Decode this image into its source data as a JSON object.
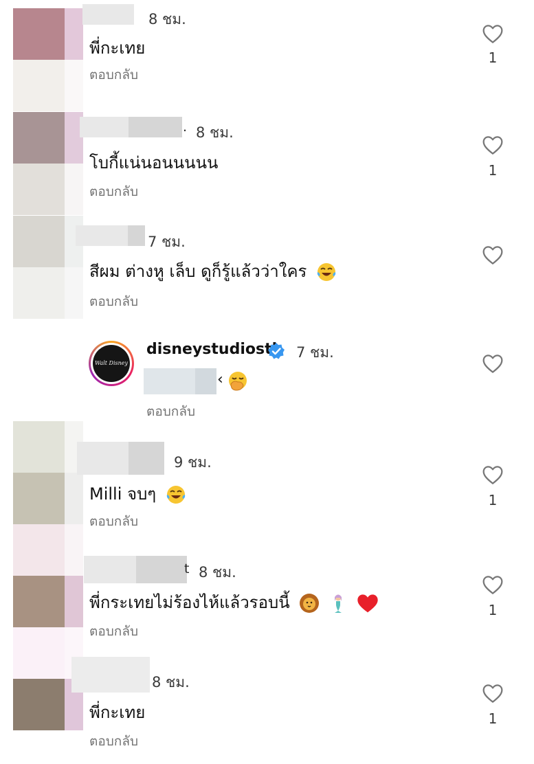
{
  "reply_label": "ตอบกลับ",
  "comments": [
    {
      "time": "8 ชม.",
      "text": "พี่กะเทย",
      "likes": "1",
      "name_tail": "",
      "emojis": []
    },
    {
      "time": "8 ชม.",
      "text": "โบกี้แน่นอนนนนน",
      "likes": "1",
      "name_tail": ".",
      "emojis": []
    },
    {
      "time": "7 ชม.",
      "text": "สีผม ต่างหู เล็บ ดูก็รู้แล้วว่าใคร",
      "likes": "",
      "name_tail": "",
      "emojis": [
        "laughing-tears"
      ]
    },
    {
      "time": "9 ชม.",
      "text": "Milli จบๆ",
      "likes": "1",
      "name_tail": "",
      "emojis": [
        "laughing-tears"
      ]
    },
    {
      "time": "8 ชม.",
      "text": "พี่กระเทยไม่ร้องไห้แล้วรอบนี้",
      "likes": "1",
      "name_tail": "t",
      "emojis": [
        "lion",
        "mermaid",
        "red-heart"
      ]
    },
    {
      "time": "8 ชม.",
      "text": "พี่กะเทย",
      "likes": "1",
      "name_tail": "",
      "emojis": []
    }
  ],
  "reply": {
    "username": "disneystudiosth",
    "time": "7 ชม.",
    "mention_tail": "‹",
    "emoji": "hand-over-mouth",
    "logo_text": "Walt Disney"
  },
  "colors": {
    "verified": "#3897f0",
    "meta_gray": "#737373"
  }
}
